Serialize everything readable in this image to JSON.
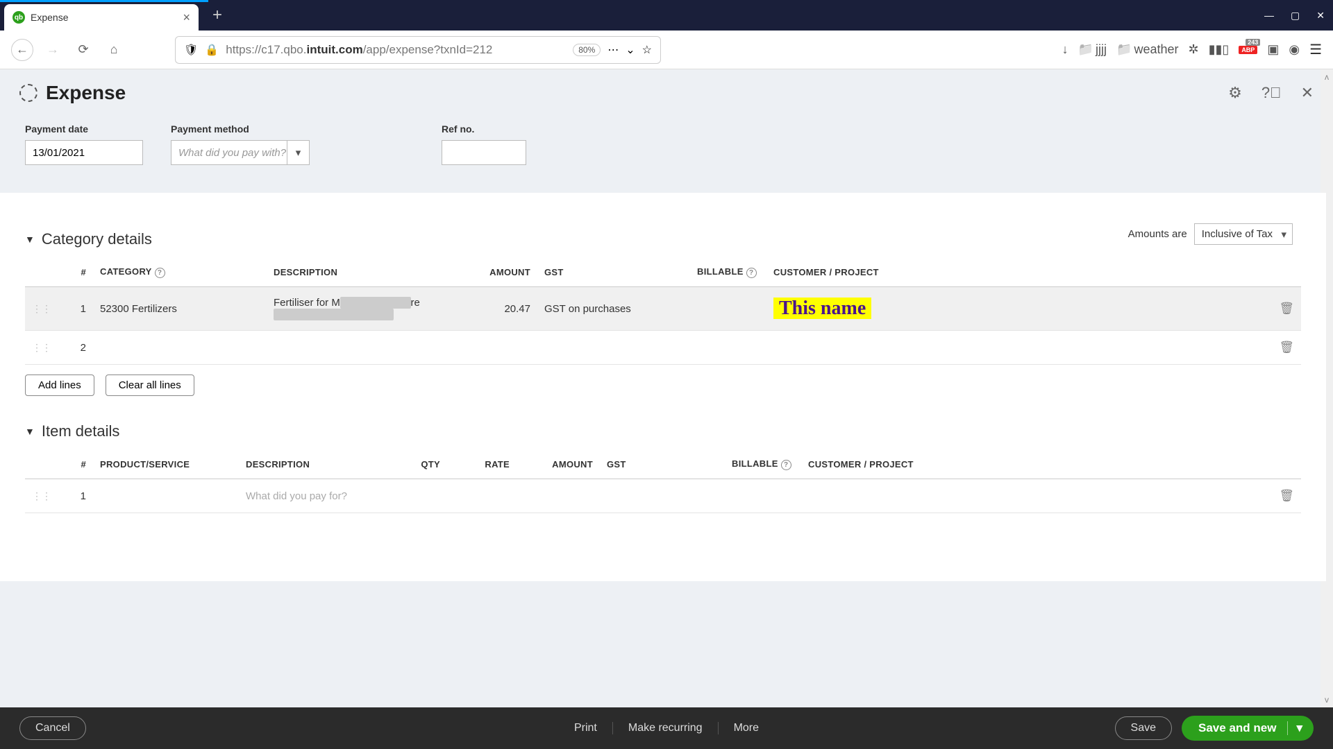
{
  "browser": {
    "tab_title": "Expense",
    "url_display_pre": "https://c17.qbo.",
    "url_display_bold": "intuit.com",
    "url_display_post": "/app/expense?txnId=212",
    "zoom": "80%",
    "bookmark_jjjj": "jjjj",
    "bookmark_weather": "weather",
    "abp_count": "243",
    "abp_label": "ABP"
  },
  "page": {
    "title": "Expense",
    "payment_date_label": "Payment date",
    "payment_date_value": "13/01/2021",
    "payment_method_label": "Payment method",
    "payment_method_placeholder": "What did you pay with?",
    "ref_label": "Ref no.",
    "amounts_are": "Amounts are",
    "amounts_value": "Inclusive of Tax"
  },
  "category": {
    "heading": "Category details",
    "cols": {
      "num": "#",
      "cat": "CATEGORY",
      "desc": "DESCRIPTION",
      "amt": "AMOUNT",
      "gst": "GST",
      "bill": "BILLABLE",
      "cust": "CUSTOMER / PROJECT"
    },
    "rows": [
      {
        "num": "1",
        "category": "52300 Fertilizers",
        "desc_pre": "Fertiliser for M",
        "desc_post": "re",
        "amount": "20.47",
        "gst": "GST on purchases",
        "annotation": "This name"
      },
      {
        "num": "2"
      }
    ],
    "add_lines": "Add lines",
    "clear_lines": "Clear all lines"
  },
  "items": {
    "heading": "Item details",
    "cols": {
      "num": "#",
      "prod": "PRODUCT/SERVICE",
      "desc": "DESCRIPTION",
      "qty": "QTY",
      "rate": "RATE",
      "amt": "AMOUNT",
      "gst": "GST",
      "bill": "BILLABLE",
      "cust": "CUSTOMER / PROJECT"
    },
    "row1_num": "1",
    "placeholder": "What did you pay for?"
  },
  "footer": {
    "cancel": "Cancel",
    "print": "Print",
    "recurring": "Make recurring",
    "more": "More",
    "save": "Save",
    "save_new": "Save and new"
  }
}
